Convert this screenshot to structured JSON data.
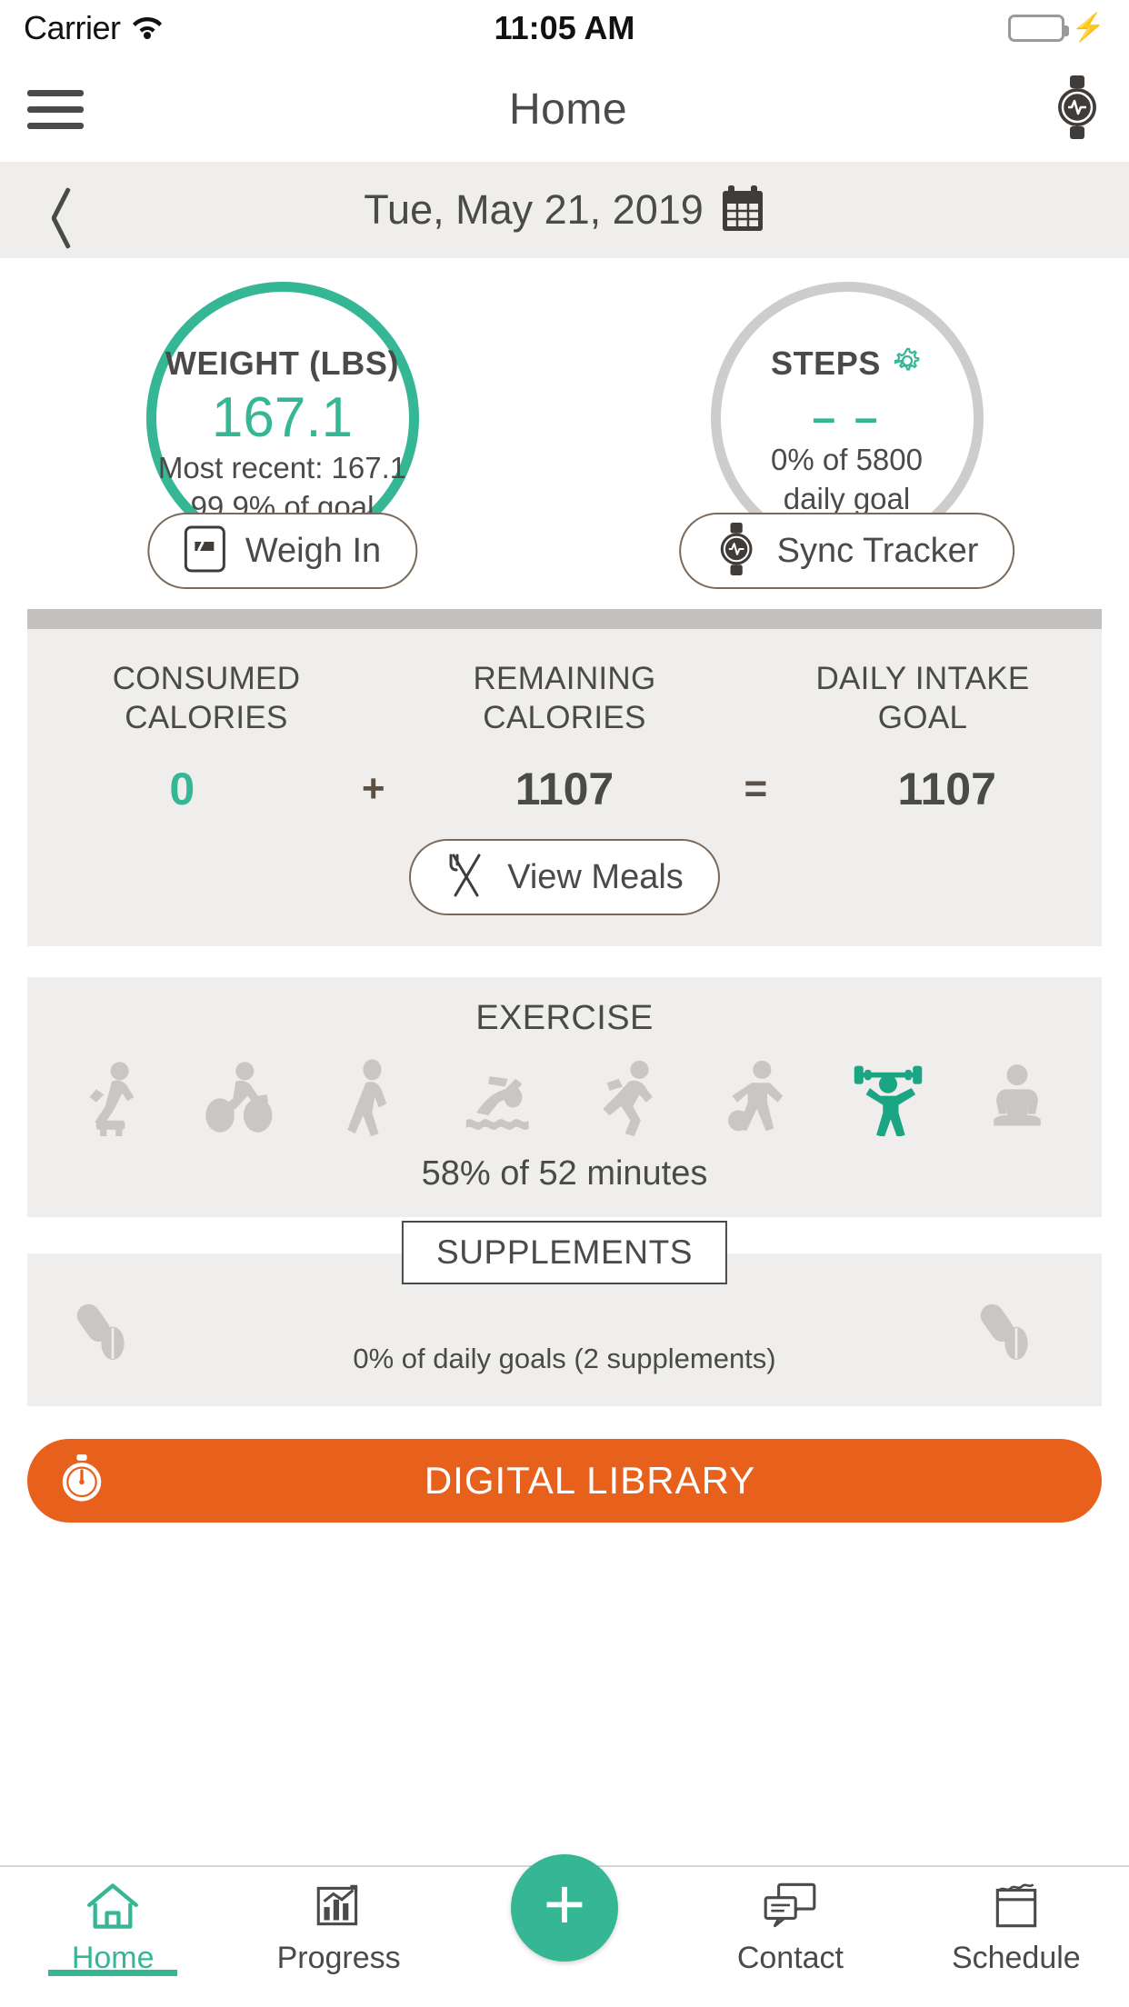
{
  "status_bar": {
    "carrier": "Carrier",
    "wifi_icon": "wifi-icon",
    "time": "11:05 AM",
    "battery_icon": "battery-full-icon",
    "charging_icon": "lightning-bolt-icon"
  },
  "nav_bar": {
    "menu_icon": "hamburger-menu-icon",
    "title": "Home",
    "tracker_icon": "smartwatch-icon"
  },
  "date_bar": {
    "back_icon": "chevron-left-icon",
    "date": "Tue, May 21, 2019",
    "calendar_icon": "calendar-icon"
  },
  "weight_card": {
    "title": "WEIGHT (LBS)",
    "value": "167.1",
    "most_recent": "Most recent: 167.1",
    "goal_percent": "99.9% of goal",
    "button_label": "Weigh In",
    "button_icon": "scale-icon",
    "ring_color": "#35b795"
  },
  "steps_card": {
    "title": "STEPS",
    "settings_icon": "gear-icon",
    "value": "– –",
    "goal_line1": "0% of 5800",
    "goal_line2": "daily goal",
    "button_label": "Sync Tracker",
    "button_icon": "smartwatch-icon",
    "ring_color": "#cfcdcb"
  },
  "calories_card": {
    "columns": [
      {
        "label_line1": "CONSUMED",
        "label_line2": "CALORIES",
        "value": "0",
        "highlight": true
      },
      {
        "label_line1": "REMAINING",
        "label_line2": "CALORIES",
        "value": "1107",
        "highlight": false
      },
      {
        "label_line1": "DAILY INTAKE",
        "label_line2": "GOAL",
        "value": "1107",
        "highlight": false
      }
    ],
    "operator_plus": "+",
    "operator_equals": "=",
    "button_label": "View Meals",
    "button_icon": "fork-knife-icon"
  },
  "exercise_card": {
    "title": "EXERCISE",
    "summary": "58% of 52 minutes",
    "active_index": 6,
    "icons": [
      "step-aerobics-icon",
      "cycling-icon",
      "walking-icon",
      "swimming-icon",
      "running-icon",
      "soccer-icon",
      "weightlifting-icon",
      "yoga-icon"
    ],
    "active_color": "#1aa583",
    "inactive_color": "#c9c7c5"
  },
  "supplements_card": {
    "label": "SUPPLEMENTS",
    "summary": "0% of daily goals (2 supplements)",
    "left_icon": "pills-icon",
    "right_icon": "pills-icon"
  },
  "banner": {
    "title": "DIGITAL LIBRARY",
    "icon": "stopwatch-icon",
    "color": "#e8611c"
  },
  "tab_bar": {
    "tabs": [
      {
        "label": "Home",
        "icon": "home-icon",
        "active": true
      },
      {
        "label": "Progress",
        "icon": "chart-icon",
        "active": false
      },
      {
        "label": "",
        "icon": "plus-icon",
        "active": false
      },
      {
        "label": "Contact",
        "icon": "chat-icon",
        "active": false
      },
      {
        "label": "Schedule",
        "icon": "calendar-icon",
        "active": false
      }
    ],
    "accent_color": "#35b795"
  }
}
